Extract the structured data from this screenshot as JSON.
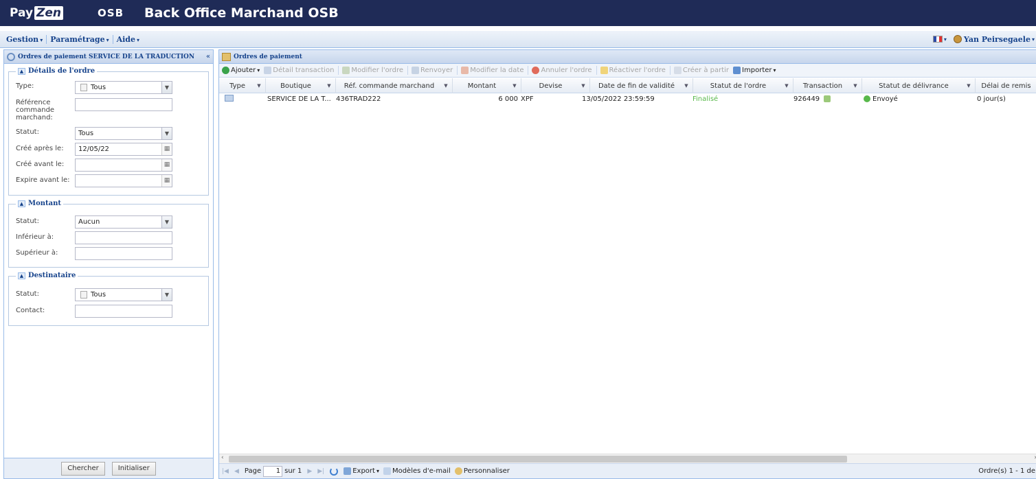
{
  "header": {
    "logo_pay": "Pay",
    "logo_zen": "Zen",
    "partner": "OSB",
    "title": "Back Office Marchand OSB"
  },
  "menubar": {
    "items": [
      {
        "label": "Gestion"
      },
      {
        "label": "Paramétrage"
      },
      {
        "label": "Aide"
      }
    ],
    "user": "Yan Peirsegaele"
  },
  "left_panel": {
    "title": "Ordres de paiement SERVICE DE LA TRADUCTION",
    "collapse_icon": "«",
    "details": {
      "legend": "Détails de l'ordre",
      "type_label": "Type:",
      "type_value": "Tous",
      "reference_label": "Référence commande marchand:",
      "reference_value": "",
      "status_label": "Statut:",
      "status_value": "Tous",
      "created_after_label": "Créé après le:",
      "created_after_value": "12/05/22",
      "created_before_label": "Créé avant le:",
      "created_before_value": "",
      "expires_before_label": "Expire avant le:",
      "expires_before_value": ""
    },
    "montant": {
      "legend": "Montant",
      "status_label": "Statut:",
      "status_value": "Aucun",
      "lower_label": "Inférieur à:",
      "lower_value": "",
      "upper_label": "Supérieur à:",
      "upper_value": ""
    },
    "destinataire": {
      "legend": "Destinataire",
      "status_label": "Statut:",
      "status_value": "Tous",
      "contact_label": "Contact:",
      "contact_value": ""
    },
    "search_button": "Chercher",
    "reset_button": "Initialiser"
  },
  "right_panel": {
    "title": "Ordres de paiement",
    "toolbar": [
      {
        "label": "Ajouter",
        "enabled": true,
        "icon": "add-icon"
      },
      {
        "label": "Détail transaction",
        "enabled": false,
        "icon": "detail-icon"
      },
      {
        "label": "Modifier l'ordre",
        "enabled": false,
        "icon": "edit-icon"
      },
      {
        "label": "Renvoyer",
        "enabled": false,
        "icon": "resend-icon"
      },
      {
        "label": "Modifier la date",
        "enabled": false,
        "icon": "calendar-icon"
      },
      {
        "label": "Annuler l'ordre",
        "enabled": false,
        "icon": "cancel-icon"
      },
      {
        "label": "Réactiver l'ordre",
        "enabled": false,
        "icon": "reactivate-icon"
      },
      {
        "label": "Créer à partir",
        "enabled": false,
        "icon": "copy-icon"
      },
      {
        "label": "Importer",
        "enabled": true,
        "icon": "import-icon"
      }
    ],
    "columns": [
      "Type",
      "Boutique",
      "Réf. commande marchand",
      "Montant",
      "Devise",
      "Date de fin de validité",
      "Statut de l'ordre",
      "Transaction",
      "Statut de délivrance",
      "Délai de remis"
    ],
    "rows": [
      {
        "boutique": "SERVICE DE LA T...",
        "reference": "436TRAD222",
        "montant": "6 000",
        "devise": "XPF",
        "date_fin": "13/05/2022 23:59:59",
        "statut_ordre": "Finalisé",
        "transaction": "926449",
        "statut_delivrance": "Envoyé",
        "delai": "0 jour(s)"
      }
    ],
    "pager": {
      "page_label": "Page",
      "page_value": "1",
      "of_label": "sur 1",
      "export_label": "Export",
      "email_models_label": "Modèles d'e-mail",
      "customize_label": "Personnaliser",
      "count_label": "Ordre(s) 1 - 1 de"
    }
  },
  "colors": {
    "header_bg": "#1f2b57",
    "accent": "#15428b",
    "status_green": "#58b84a"
  }
}
